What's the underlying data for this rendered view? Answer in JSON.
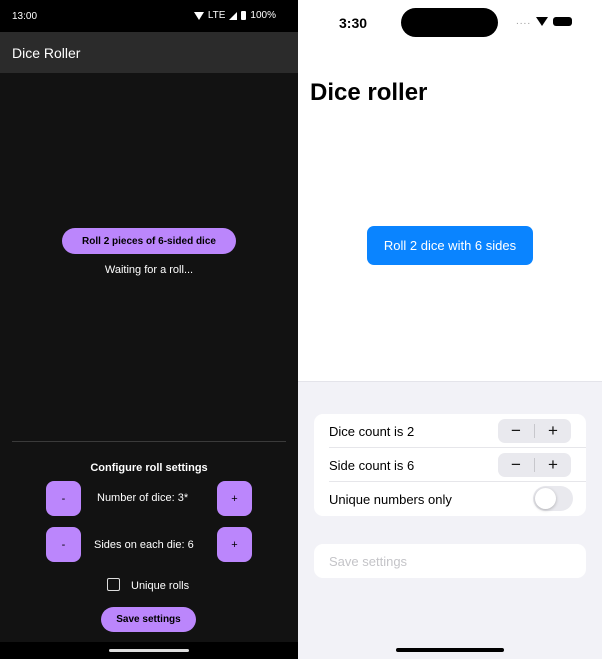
{
  "android": {
    "status": {
      "time": "13:00",
      "network": "LTE",
      "battery": "100%"
    },
    "app_title": "Dice Roller",
    "roll_button_label": "Roll 2 pieces of 6-sided dice",
    "roll_status": "Waiting for a roll...",
    "config_heading": "Configure roll settings",
    "dice_row": {
      "minus_label": "-",
      "text": "Number of dice: 3*",
      "plus_label": "+"
    },
    "sides_row": {
      "minus_label": "-",
      "text": "Sides on each die: 6",
      "plus_label": "+"
    },
    "unique_label": "Unique rolls",
    "unique_checked": false,
    "save_label": "Save settings",
    "accent_color": "#bb86fc",
    "background_color": "#121212"
  },
  "ios": {
    "status": {
      "time": "3:30"
    },
    "title": "Dice roller",
    "roll_button_label": "Roll 2 dice with 6 sides",
    "settings": {
      "dice_count_label": "Dice count is 2",
      "side_count_label": "Side count is 6",
      "stepper_minus": "−",
      "stepper_plus": "+",
      "unique_label": "Unique numbers only",
      "unique_on": false
    },
    "save_label": "Save settings",
    "accent_color": "#0a84ff",
    "background_color": "#f2f2f7"
  }
}
